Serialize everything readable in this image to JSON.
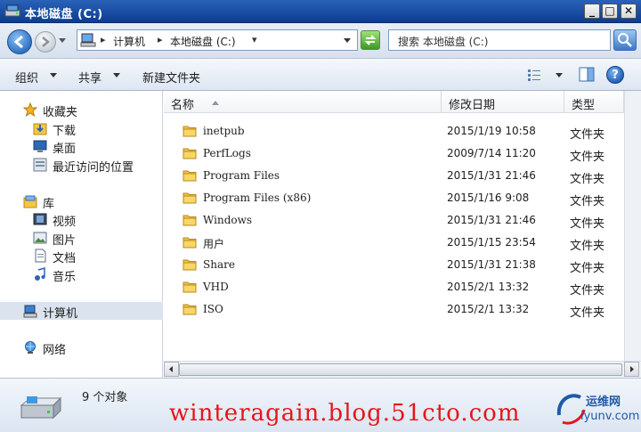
{
  "window": {
    "title": "本地磁盘 (C:)"
  },
  "address": {
    "crumbs": [
      "计算机",
      "本地磁盘 (C:)"
    ]
  },
  "search": {
    "placeholder": "搜索 本地磁盘 (C:)"
  },
  "toolbar": {
    "organize": "组织",
    "share": "共享",
    "new_folder": "新建文件夹"
  },
  "navpane": {
    "favorites": "收藏夹",
    "favorites_items": [
      "下载",
      "桌面",
      "最近访问的位置"
    ],
    "libraries": "库",
    "library_items": [
      "视频",
      "图片",
      "文档",
      "音乐"
    ],
    "computer": "计算机",
    "network": "网络"
  },
  "columns": {
    "name": "名称",
    "date": "修改日期",
    "type": "类型"
  },
  "files": [
    {
      "name": "inetpub",
      "date": "2015/1/19 10:58",
      "type": "文件夹"
    },
    {
      "name": "PerfLogs",
      "date": "2009/7/14 11:20",
      "type": "文件夹"
    },
    {
      "name": "Program Files",
      "date": "2015/1/31 21:46",
      "type": "文件夹"
    },
    {
      "name": "Program Files (x86)",
      "date": "2015/1/16 9:08",
      "type": "文件夹"
    },
    {
      "name": "Windows",
      "date": "2015/1/31 21:46",
      "type": "文件夹"
    },
    {
      "name": "用户",
      "date": "2015/1/15 23:54",
      "type": "文件夹"
    },
    {
      "name": "Share",
      "date": "2015/1/31 21:38",
      "type": "文件夹"
    },
    {
      "name": "VHD",
      "date": "2015/2/1 13:32",
      "type": "文件夹"
    },
    {
      "name": "ISO",
      "date": "2015/2/1 13:32",
      "type": "文件夹"
    }
  ],
  "status": {
    "count": "9 个对象"
  },
  "watermark": {
    "text": "winteragain.blog.51cto.com",
    "logo_cn": "运维网",
    "logo_url": "iyunv.com"
  },
  "colors": {
    "titlebar": "#0b3d91",
    "watermark": "#e8141b",
    "folder": "#f3c644"
  }
}
